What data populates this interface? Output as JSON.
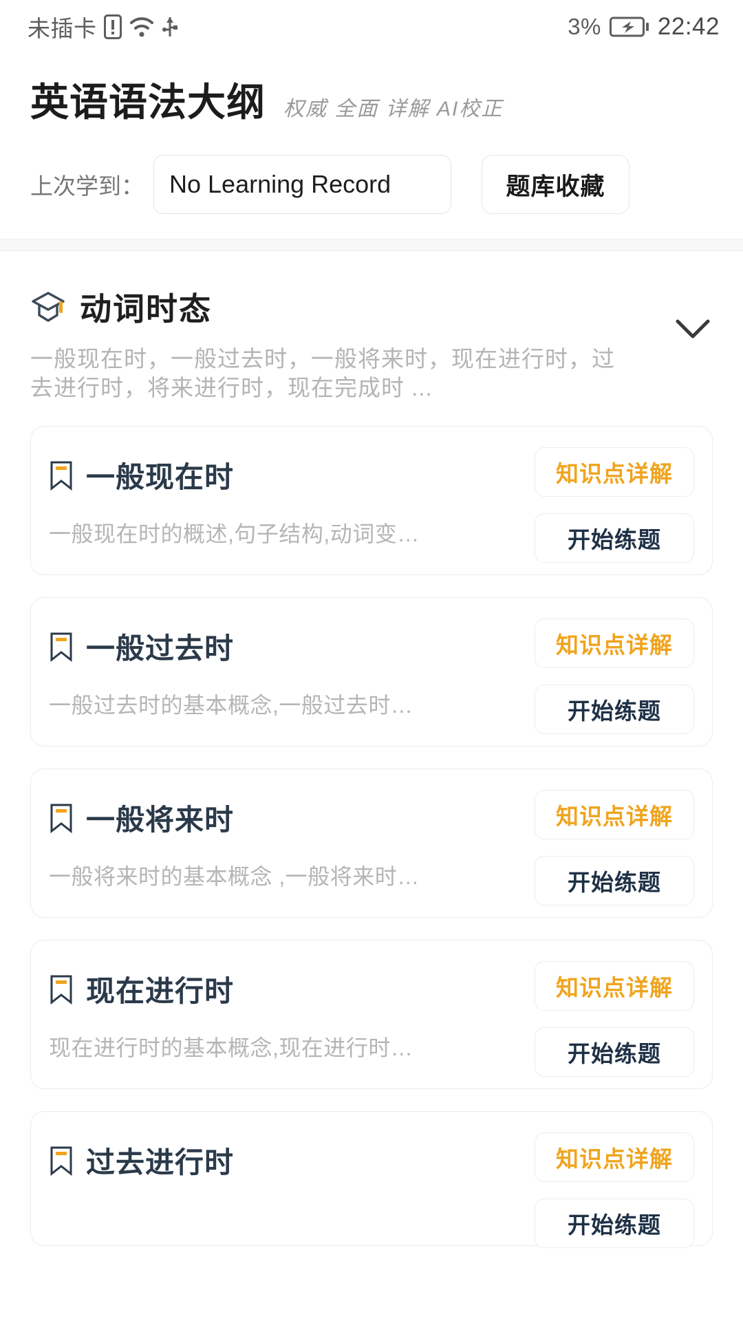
{
  "statusbar": {
    "carrier": "未插卡",
    "icons": [
      "sim-alert-icon",
      "wifi-icon",
      "usb-icon"
    ],
    "battery_percent": "3%",
    "battery_icon": "battery-charging-icon",
    "time": "22:42"
  },
  "header": {
    "title": "英语语法大纲",
    "subtitle": "权威 全面 详解 AI校正",
    "record_label": "上次学到：",
    "record_value": "No Learning Record",
    "favorites_button": "题库收藏"
  },
  "section": {
    "icon": "graduation-cap-icon",
    "title": "动词时态",
    "description": "一般现在时，一般过去时，一般将来时，现在进行时，过去进行时，将来进行时，现在完成时 ...",
    "toggle_icon": "chevron-down-icon"
  },
  "buttons": {
    "detail": "知识点详解",
    "practice": "开始练题"
  },
  "colors": {
    "accent_orange": "#f0a41e",
    "dark_navy": "#1f3146",
    "muted_gray": "#b5b5b5",
    "border_gray": "#ececec"
  },
  "cards": [
    {
      "icon": "bookmark-icon",
      "title": "一般现在时",
      "description": "一般现在时的概述,句子结构,动词变…"
    },
    {
      "icon": "bookmark-icon",
      "title": "一般过去时",
      "description": "一般过去时的基本概念,一般过去时…"
    },
    {
      "icon": "bookmark-icon",
      "title": "一般将来时",
      "description": "一般将来时的基本概念 ,一般将来时…"
    },
    {
      "icon": "bookmark-icon",
      "title": "现在进行时",
      "description": "现在进行时的基本概念,现在进行时…"
    },
    {
      "icon": "bookmark-icon",
      "title": "过去进行时",
      "description": ""
    }
  ]
}
